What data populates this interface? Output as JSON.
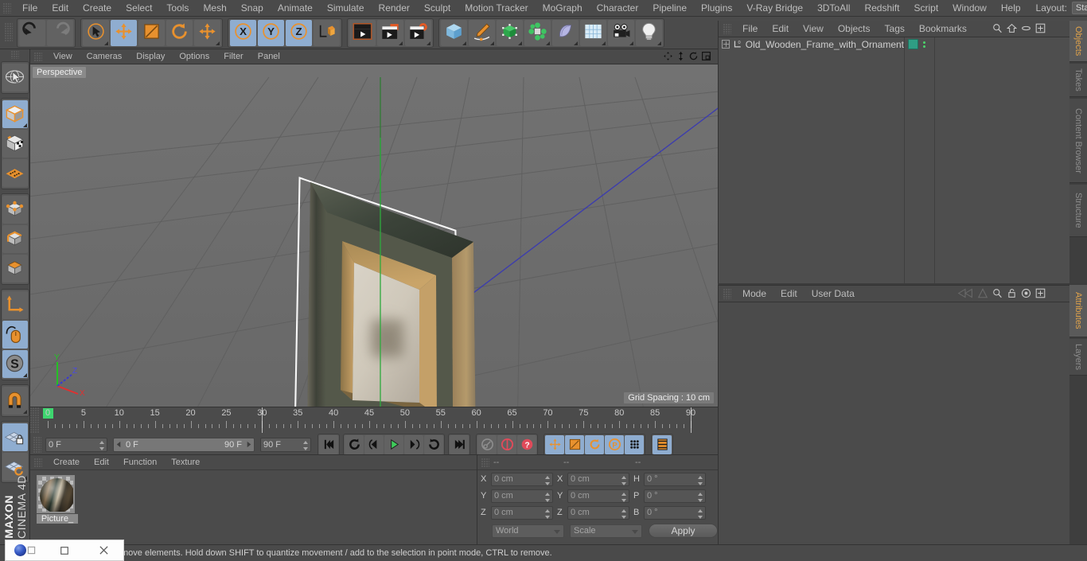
{
  "app": {
    "brand_bold": "MAXON",
    "brand_reg": "CINEMA 4D"
  },
  "menubar": {
    "items": [
      "File",
      "Edit",
      "Create",
      "Select",
      "Tools",
      "Mesh",
      "Snap",
      "Animate",
      "Simulate",
      "Render",
      "Sculpt",
      "Motion Tracker",
      "MoGraph",
      "Character",
      "Pipeline",
      "Plugins",
      "V-Ray Bridge",
      "3DToAll",
      "Redshift",
      "Script",
      "Window",
      "Help"
    ],
    "layout_label": "Layout:",
    "layout_value": "Startup",
    "right_icons": [
      "search-icon",
      "home-icon",
      "ellipse-icon",
      "plus-box-icon"
    ]
  },
  "toolbar": {
    "groups": [
      {
        "name": "undo-redo",
        "buttons": [
          {
            "icon": "undo-icon",
            "selected": false,
            "corner": false
          },
          {
            "icon": "redo-icon",
            "selected": false,
            "corner": false
          }
        ]
      },
      {
        "name": "transform-tools",
        "buttons": [
          {
            "icon": "selection-icon",
            "selected": false,
            "corner": true
          },
          {
            "icon": "move-icon",
            "selected": true,
            "corner": false
          },
          {
            "icon": "scale-icon",
            "selected": false,
            "corner": false
          },
          {
            "icon": "rotate-icon",
            "selected": false,
            "corner": false
          },
          {
            "icon": "move-alt-icon",
            "selected": false,
            "corner": true
          }
        ]
      },
      {
        "name": "axis-locks",
        "buttons": [
          {
            "icon": "x-axis-icon",
            "selected": true,
            "corner": false
          },
          {
            "icon": "y-axis-icon",
            "selected": true,
            "corner": false
          },
          {
            "icon": "z-axis-icon",
            "selected": true,
            "corner": false
          },
          {
            "icon": "world-object-axis-icon",
            "selected": false,
            "corner": false
          }
        ]
      },
      {
        "name": "render-tools",
        "buttons": [
          {
            "icon": "render-view-icon",
            "selected": false,
            "corner": false
          },
          {
            "icon": "render-region-icon",
            "selected": false,
            "corner": true
          },
          {
            "icon": "render-settings-icon",
            "selected": false,
            "corner": true
          }
        ]
      },
      {
        "name": "create-objects",
        "buttons": [
          {
            "icon": "cube-primitive-icon",
            "selected": false,
            "corner": true
          },
          {
            "icon": "spline-pen-icon",
            "selected": false,
            "corner": true
          },
          {
            "icon": "generator-icon",
            "selected": false,
            "corner": true
          },
          {
            "icon": "mograph-cloner-icon",
            "selected": false,
            "corner": true
          },
          {
            "icon": "deformer-icon",
            "selected": false,
            "corner": true
          },
          {
            "icon": "scene-floor-icon",
            "selected": false,
            "corner": true
          },
          {
            "icon": "camera-icon",
            "selected": false,
            "corner": true
          },
          {
            "icon": "light-icon",
            "selected": false,
            "corner": true
          }
        ]
      }
    ]
  },
  "left_toolbar": {
    "groups": [
      {
        "buttons": [
          {
            "icon": "live-selection-globe-icon",
            "selected": false,
            "corner": false
          }
        ]
      },
      {
        "buttons": [
          {
            "icon": "model-mode-icon",
            "selected": true,
            "corner": true
          },
          {
            "icon": "texture-mode-icon",
            "selected": false,
            "corner": false
          },
          {
            "icon": "workplane-mode-icon",
            "selected": false,
            "corner": false
          }
        ]
      },
      {
        "buttons": [
          {
            "icon": "points-mode-icon",
            "selected": false,
            "corner": false
          },
          {
            "icon": "edges-mode-icon",
            "selected": false,
            "corner": false
          },
          {
            "icon": "polygons-mode-icon",
            "selected": false,
            "corner": false
          }
        ]
      },
      {
        "buttons": [
          {
            "icon": "object-axis-icon",
            "selected": false,
            "corner": false
          },
          {
            "icon": "enable-axis-mouse-icon",
            "selected": true,
            "corner": false
          },
          {
            "icon": "soft-selection-icon",
            "selected": true,
            "corner": true
          }
        ]
      },
      {
        "buttons": [
          {
            "icon": "magnet-icon",
            "selected": false,
            "corner": true
          }
        ]
      },
      {
        "buttons": [
          {
            "icon": "workplane-lock-icon",
            "selected": true,
            "corner": false
          },
          {
            "icon": "workplane-rotate-icon",
            "selected": false,
            "corner": true
          }
        ]
      }
    ]
  },
  "viewport": {
    "menu": [
      "View",
      "Cameras",
      "Display",
      "Options",
      "Filter",
      "Panel"
    ],
    "corner_icons": [
      "pan-icon",
      "dolly-icon",
      "rotate-view-icon",
      "maximize-view-icon"
    ],
    "label": "Perspective",
    "grid_spacing": "Grid Spacing : 10 cm",
    "axis_labels": {
      "x": "X",
      "y": "Y",
      "z": "Z"
    }
  },
  "timeline": {
    "tick_labels": [
      "0",
      "5",
      "10",
      "15",
      "20",
      "25",
      "30",
      "35",
      "40",
      "45",
      "50",
      "55",
      "60",
      "65",
      "70",
      "75",
      "80",
      "85",
      "90"
    ],
    "current_frame": "0 F",
    "range_start": "0 F",
    "range_end": "90 F",
    "end_frame": "90 F",
    "preview_frame": "0 F",
    "transport": [
      {
        "icon": "go-to-start-icon",
        "selected": false
      },
      {
        "icon": "play-backwards-loop-icon",
        "selected": false
      },
      {
        "icon": "step-back-icon",
        "selected": false
      },
      {
        "icon": "play-icon",
        "selected": false
      },
      {
        "icon": "step-forward-icon",
        "selected": false
      },
      {
        "icon": "play-forward-loop-icon",
        "selected": false
      },
      {
        "icon": "go-to-end-icon",
        "selected": false
      }
    ],
    "record_tools": [
      {
        "icon": "autokey-icon",
        "selected": false
      },
      {
        "icon": "record-keyframe-icon",
        "selected": false
      },
      {
        "icon": "keyframe-selection-icon",
        "selected": false
      }
    ],
    "param_tools": [
      {
        "icon": "position-key-icon",
        "selected": true
      },
      {
        "icon": "scale-key-icon",
        "selected": true
      },
      {
        "icon": "rotation-key-icon",
        "selected": true
      },
      {
        "icon": "pla-key-icon",
        "selected": true
      },
      {
        "icon": "point-level-anim-icon",
        "selected": true
      }
    ],
    "timeline_toggle": {
      "icon": "timeline-filmstrip-icon",
      "selected": true
    }
  },
  "materials": {
    "menu": [
      "Create",
      "Edit",
      "Function",
      "Texture"
    ],
    "items": [
      {
        "name": "Picture_",
        "thumb": "material-sphere-preview"
      }
    ]
  },
  "coordinates": {
    "header": [
      "--",
      "--",
      "--"
    ],
    "rows": [
      {
        "pos_label": "X",
        "pos_value": "0 cm",
        "size_label": "X",
        "size_value": "0 cm",
        "rot_label": "H",
        "rot_value": "0 °"
      },
      {
        "pos_label": "Y",
        "pos_value": "0 cm",
        "size_label": "Y",
        "size_value": "0 cm",
        "rot_label": "P",
        "rot_value": "0 °"
      },
      {
        "pos_label": "Z",
        "pos_value": "0 cm",
        "size_label": "Z",
        "size_value": "0 cm",
        "rot_label": "B",
        "rot_value": "0 °"
      }
    ],
    "coord_system": "World",
    "transform_mode": "Scale",
    "apply_label": "Apply"
  },
  "object_manager": {
    "menu": [
      "File",
      "Edit",
      "View",
      "Objects",
      "Tags",
      "Bookmarks"
    ],
    "right_icons": [
      "search-icon",
      "home-icon",
      "ellipse-icon",
      "plus-box-icon"
    ],
    "object_name": "Old_Wooden_Frame_with_Ornament",
    "layer_badge": "0"
  },
  "attributes": {
    "menu": [
      "Mode",
      "Edit",
      "User Data"
    ],
    "right_icons": [
      "back-nav-icon",
      "forward-nav-icon",
      "search-icon",
      "lock-icon",
      "target-icon",
      "plus-box-icon"
    ]
  },
  "vertical_tabs_top": [
    {
      "label": "Objects",
      "active": true
    },
    {
      "label": "Takes",
      "active": false
    },
    {
      "label": "Content Browser",
      "active": false
    },
    {
      "label": "Structure",
      "active": false
    }
  ],
  "vertical_tabs_bottom": [
    {
      "label": "Attributes",
      "active": true
    },
    {
      "label": "Layers",
      "active": false
    }
  ],
  "statusbar": {
    "text": "move elements. Hold down SHIFT to quantize movement / add to the selection in point mode, CTRL to remove."
  },
  "mini_window": {
    "buttons": [
      "c4d-logo-icon",
      "restore-icon",
      "close-icon"
    ]
  },
  "colors": {
    "accent_orange": "#e0a24a",
    "selection_blue": "#8fadd0",
    "panel_bg": "#4b4b4b",
    "viewport_bg": "#6b6b6b",
    "tag_green": "#2f9e84",
    "marker_green": "#3ed66f"
  }
}
